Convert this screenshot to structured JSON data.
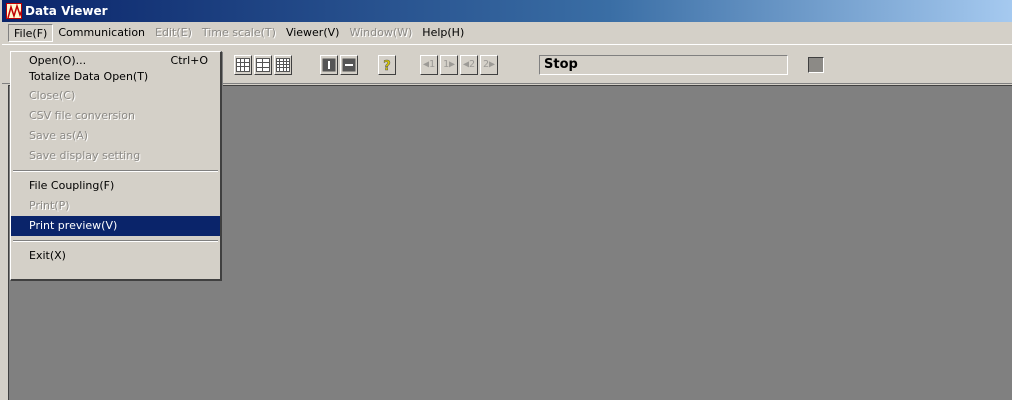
{
  "window": {
    "title": "Data Viewer"
  },
  "menubar": {
    "items": [
      {
        "label": "File(F)",
        "enabled": true
      },
      {
        "label": "Communication",
        "enabled": true
      },
      {
        "label": "Edit(E)",
        "enabled": false
      },
      {
        "label": "Time scale(T)",
        "enabled": false
      },
      {
        "label": "Viewer(V)",
        "enabled": true
      },
      {
        "label": "Window(W)",
        "enabled": false
      },
      {
        "label": "Help(H)",
        "enabled": true
      }
    ]
  },
  "file_menu": {
    "items": [
      {
        "label": "Open(O)...",
        "shortcut": "Ctrl+O",
        "enabled": true
      },
      {
        "label": "Totalize Data Open(T)",
        "enabled": true
      },
      {
        "label": "Close(C)",
        "enabled": false
      },
      {
        "label": "CSV file conversion",
        "enabled": false
      },
      {
        "label": "Save as(A)",
        "enabled": false
      },
      {
        "label": "Save display setting",
        "enabled": false
      },
      {
        "label": "File Coupling(F)",
        "enabled": true
      },
      {
        "label": "Print(P)",
        "enabled": false
      },
      {
        "label": "Print preview(V)",
        "enabled": true,
        "selected": true
      },
      {
        "label": "Exit(X)",
        "enabled": true
      }
    ]
  },
  "toolbar": {
    "status_text": "Stop",
    "buttons": [
      {
        "icon": "grid-icon"
      },
      {
        "icon": "split-grid-icon"
      },
      {
        "icon": "table-icon"
      },
      {
        "icon": "cursor-left-icon"
      },
      {
        "icon": "cursor-right-icon"
      },
      {
        "icon": "help-question-icon"
      },
      {
        "icon": "cursor1-back-icon",
        "label": "1"
      },
      {
        "icon": "cursor1-forward-icon",
        "label": "1"
      },
      {
        "icon": "cursor2-back-icon",
        "label": "2"
      },
      {
        "icon": "cursor2-forward-icon",
        "label": "2"
      }
    ]
  },
  "colors": {
    "title_bar_start": "#0a246a",
    "title_bar_end": "#a6caf0",
    "face": "#d4d0c8",
    "workspace": "#808080",
    "highlight": "#0a246a"
  }
}
